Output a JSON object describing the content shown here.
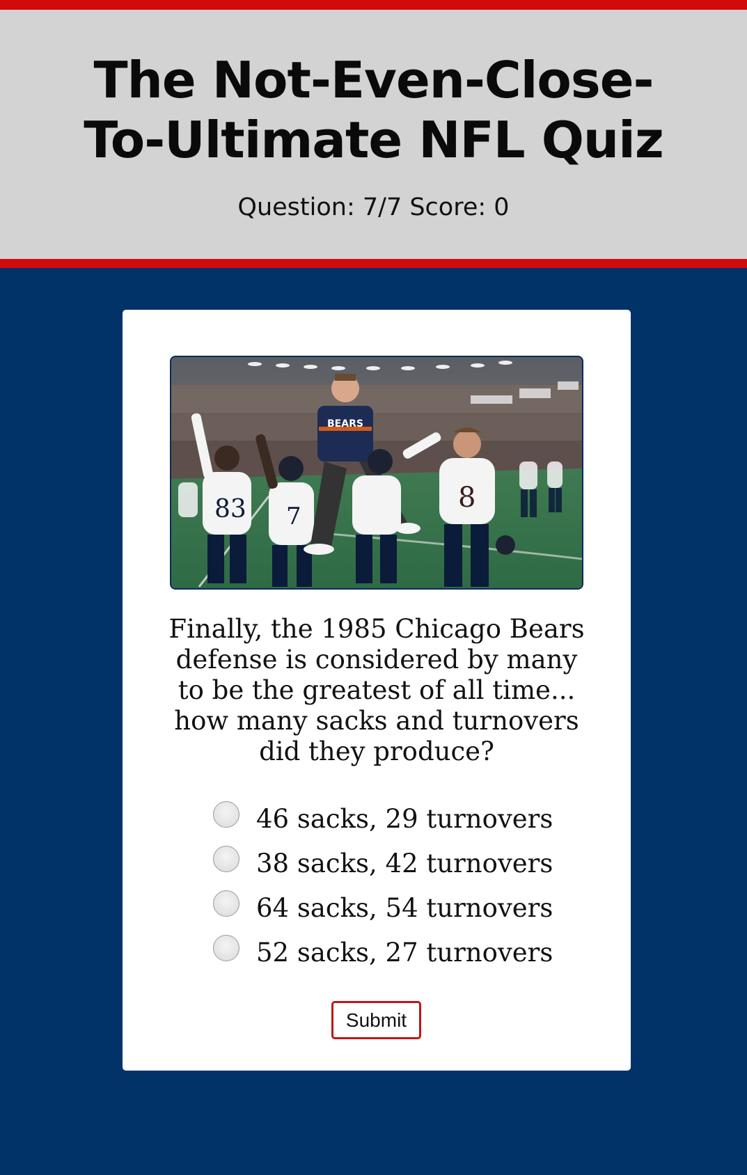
{
  "header": {
    "title": "The Not-Even-Close-To-Ultimate NFL Quiz",
    "progress_text": "Question: 7/7 Score: 0"
  },
  "quiz": {
    "question": "Finally, the 1985 Chicago Bears defense is considered by many to be the greatest of all time... how many sacks and turnovers did they produce?",
    "options": [
      {
        "label": "46 sacks, 29 turnovers",
        "selected": false
      },
      {
        "label": "38 sacks, 42 turnovers",
        "selected": false
      },
      {
        "label": "64 sacks, 54 turnovers",
        "selected": false
      },
      {
        "label": "52 sacks, 27 turnovers",
        "selected": false
      }
    ],
    "submit_label": "Submit",
    "photo_icon": "team-celebration-photo"
  },
  "colors": {
    "page_background": "#013369",
    "header_background": "#d3d3d3",
    "accent_red": "#d10a0a",
    "card_background": "#ffffff"
  }
}
